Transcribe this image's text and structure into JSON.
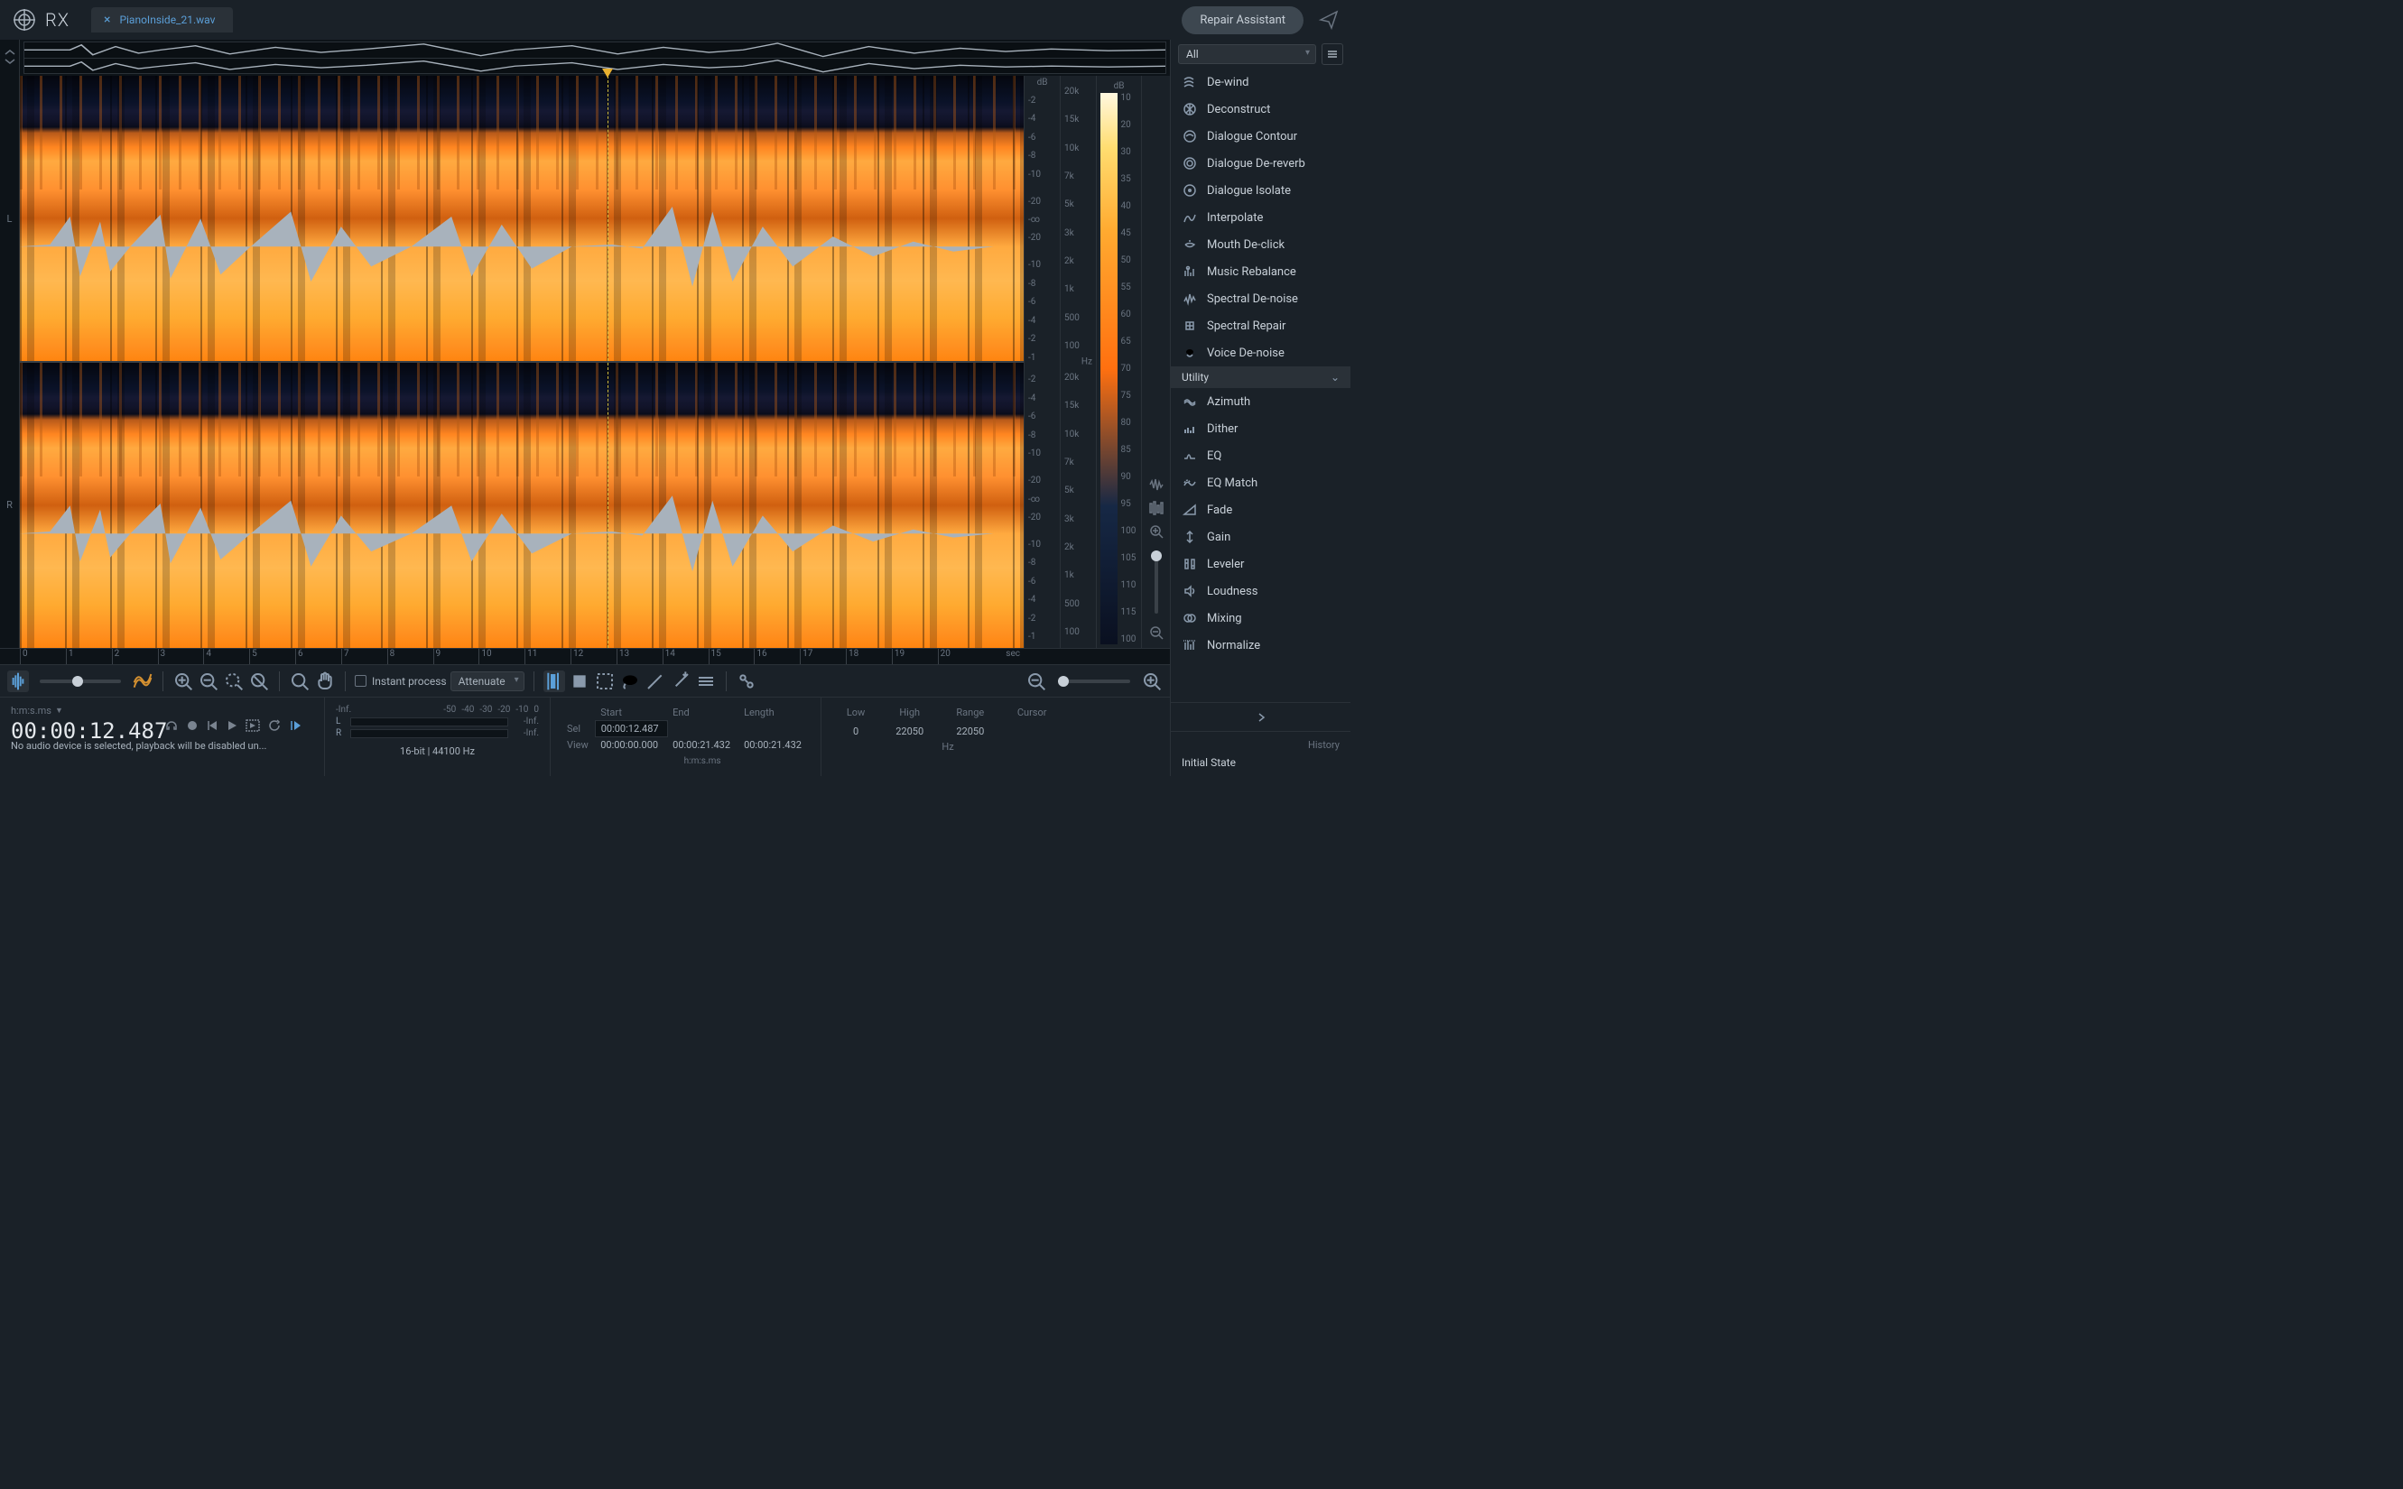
{
  "topbar": {
    "app_name": "RX",
    "file_tab": "PianoInside_21.wav",
    "repair_assistant": "Repair Assistant"
  },
  "channels": [
    "L",
    "R"
  ],
  "db_ruler": {
    "header": "dB",
    "ticks": [
      "-2",
      "-4",
      "-6",
      "-8",
      "-10",
      "",
      "-20",
      "-∞",
      "-20",
      "",
      "-10",
      "-8",
      "-6",
      "-4",
      "-2",
      "-1"
    ]
  },
  "hz_ruler": {
    "header": "Hz",
    "ticks": [
      "20k",
      "15k",
      "10k",
      "7k",
      "5k",
      "3k",
      "2k",
      "1k",
      "500",
      "100"
    ]
  },
  "color_ruler": {
    "header": "dB",
    "ticks": [
      "10",
      "20",
      "30",
      "35",
      "40",
      "45",
      "50",
      "55",
      "60",
      "65",
      "70",
      "75",
      "80",
      "85",
      "90",
      "95",
      "100",
      "105",
      "110",
      "115",
      "100"
    ]
  },
  "time_ruler": {
    "unit": "sec",
    "ticks": [
      "0",
      "1",
      "2",
      "3",
      "4",
      "5",
      "6",
      "7",
      "8",
      "9",
      "10",
      "11",
      "12",
      "13",
      "14",
      "15",
      "16",
      "17",
      "18",
      "19",
      "20"
    ]
  },
  "toolbar": {
    "instant_process": "Instant process",
    "mode_selected": "Attenuate"
  },
  "transport": {
    "format_label": "h:m:s.ms",
    "timecode": "00:00:12.487",
    "status_message": "No audio device is selected, playback will be disabled un..."
  },
  "meters": {
    "header_peak": "-Inf.",
    "header_ticks": [
      "-50",
      "-40",
      "-30",
      "-20",
      "-10",
      "0"
    ],
    "L": {
      "label": "L",
      "value": "-Inf."
    },
    "R": {
      "label": "R",
      "value": "-Inf."
    },
    "file_info": "16-bit | 44100 Hz"
  },
  "selection": {
    "cols": {
      "start": "Start",
      "end": "End",
      "length": "Length"
    },
    "rows": {
      "sel": {
        "label": "Sel",
        "start": "00:00:12.487",
        "end": "",
        "length": ""
      },
      "view": {
        "label": "View",
        "start": "00:00:00.000",
        "end": "00:00:21.432",
        "length": "00:00:21.432"
      }
    },
    "unit": "h:m:s.ms"
  },
  "freq": {
    "cols": {
      "low": "Low",
      "high": "High",
      "range": "Range",
      "cursor": "Cursor"
    },
    "row": {
      "low": "0",
      "high": "22050",
      "range": "22050",
      "cursor": ""
    },
    "unit": "Hz"
  },
  "sidebar": {
    "filter_selected": "All",
    "modules": [
      {
        "name": "De-wind",
        "icon": "dewind"
      },
      {
        "name": "Deconstruct",
        "icon": "deconstruct"
      },
      {
        "name": "Dialogue Contour",
        "icon": "contour"
      },
      {
        "name": "Dialogue De-reverb",
        "icon": "dereverb"
      },
      {
        "name": "Dialogue Isolate",
        "icon": "isolate"
      },
      {
        "name": "Interpolate",
        "icon": "interpolate"
      },
      {
        "name": "Mouth De-click",
        "icon": "mouth"
      },
      {
        "name": "Music Rebalance",
        "icon": "rebalance"
      },
      {
        "name": "Spectral De-noise",
        "icon": "spectral-denoise"
      },
      {
        "name": "Spectral Repair",
        "icon": "spectral-repair"
      },
      {
        "name": "Voice De-noise",
        "icon": "voice-denoise"
      }
    ],
    "utility_header": "Utility",
    "utility": [
      {
        "name": "Azimuth",
        "icon": "azimuth"
      },
      {
        "name": "Dither",
        "icon": "dither"
      },
      {
        "name": "EQ",
        "icon": "eq"
      },
      {
        "name": "EQ Match",
        "icon": "eqmatch"
      },
      {
        "name": "Fade",
        "icon": "fade"
      },
      {
        "name": "Gain",
        "icon": "gain"
      },
      {
        "name": "Leveler",
        "icon": "leveler"
      },
      {
        "name": "Loudness",
        "icon": "loudness"
      },
      {
        "name": "Mixing",
        "icon": "mixing"
      },
      {
        "name": "Normalize",
        "icon": "normalize"
      }
    ],
    "history_header": "History",
    "history_items": [
      "Initial State"
    ]
  }
}
